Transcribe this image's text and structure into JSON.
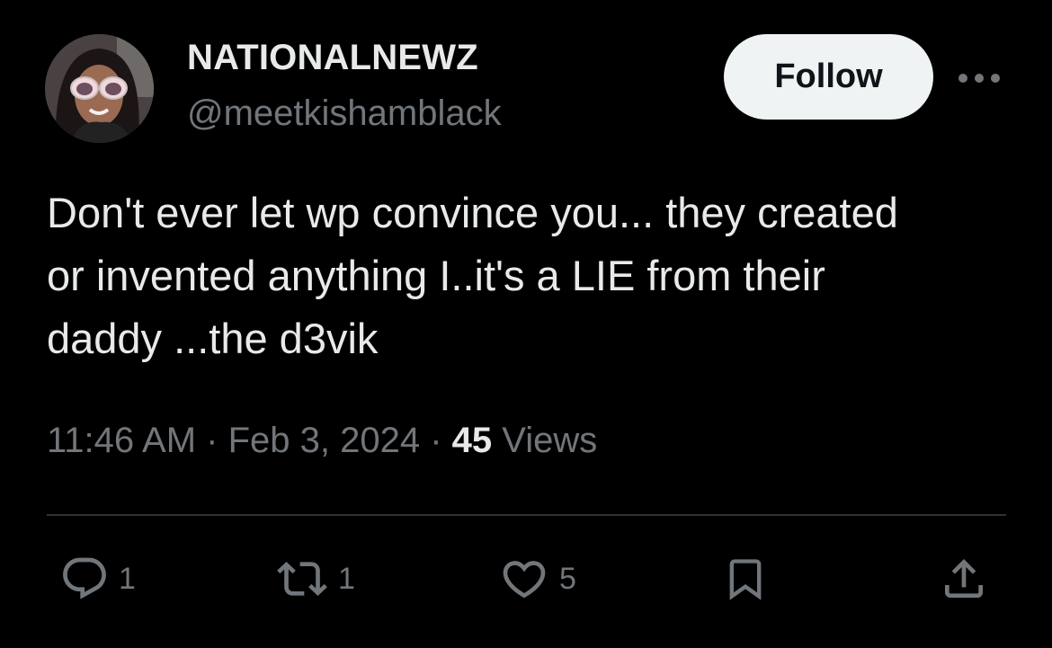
{
  "author": {
    "display_name": "NATIONALNEWZ",
    "handle": "@meetkishamblack",
    "avatar_icon": "user-avatar-photo"
  },
  "header": {
    "follow_label": "Follow",
    "more_icon": "more-horizontal-icon"
  },
  "tweet": {
    "text": "Don't ever let wp convince you... they created\nor invented anything I..it's a LIE from their\ndaddy ...the d3vik"
  },
  "meta": {
    "time": "11:46 AM",
    "separator": " · ",
    "date": "Feb 3, 2024",
    "views_count": "45",
    "views_label": " Views"
  },
  "actions": {
    "reply": {
      "icon": "reply-icon",
      "count": "1"
    },
    "repost": {
      "icon": "repost-icon",
      "count": "1"
    },
    "like": {
      "icon": "heart-icon",
      "count": "5"
    },
    "bookmark": {
      "icon": "bookmark-icon"
    },
    "share": {
      "icon": "share-icon"
    }
  },
  "colors": {
    "background": "#000000",
    "primary_text": "#e7e9ea",
    "secondary_text": "#71767b",
    "follow_bg": "#eff3f4",
    "divider": "#2f3336"
  }
}
